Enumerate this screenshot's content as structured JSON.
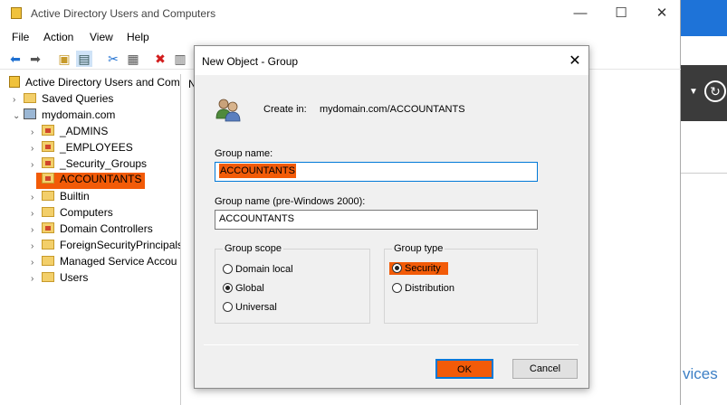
{
  "window": {
    "title": "Active Directory Users and Computers"
  },
  "menu": [
    "File",
    "Action",
    "View",
    "Help"
  ],
  "tree": {
    "root": "Active Directory Users and Com",
    "saved_queries": "Saved Queries",
    "domain": "mydomain.com",
    "items": [
      "_ADMINS",
      "_EMPLOYEES",
      "_Security_Groups",
      "ACCOUNTANTS",
      "Builtin",
      "Computers",
      "Domain Controllers",
      "ForeignSecurityPrincipals",
      "Managed Service Accou",
      "Users"
    ]
  },
  "detail_char": "N",
  "background_app": {
    "partial_text": "vices"
  },
  "dialog": {
    "title": "New Object - Group",
    "create_in_label": "Create in:",
    "create_in_value": "mydomain.com/ACCOUNTANTS",
    "group_name_label": "Group name:",
    "group_name_value": "ACCOUNTANTS",
    "pre2000_label": "Group name (pre-Windows 2000):",
    "pre2000_value": "ACCOUNTANTS",
    "group_scope": {
      "title": "Group scope",
      "options": [
        "Domain local",
        "Global",
        "Universal"
      ],
      "selected": "Global"
    },
    "group_type": {
      "title": "Group type",
      "options": [
        "Security",
        "Distribution"
      ],
      "selected": "Security"
    },
    "ok_label": "OK",
    "cancel_label": "Cancel"
  },
  "colors": {
    "highlight": "#f25b08",
    "focus": "#0078d7",
    "dialog_bg": "#f0f0f0"
  }
}
